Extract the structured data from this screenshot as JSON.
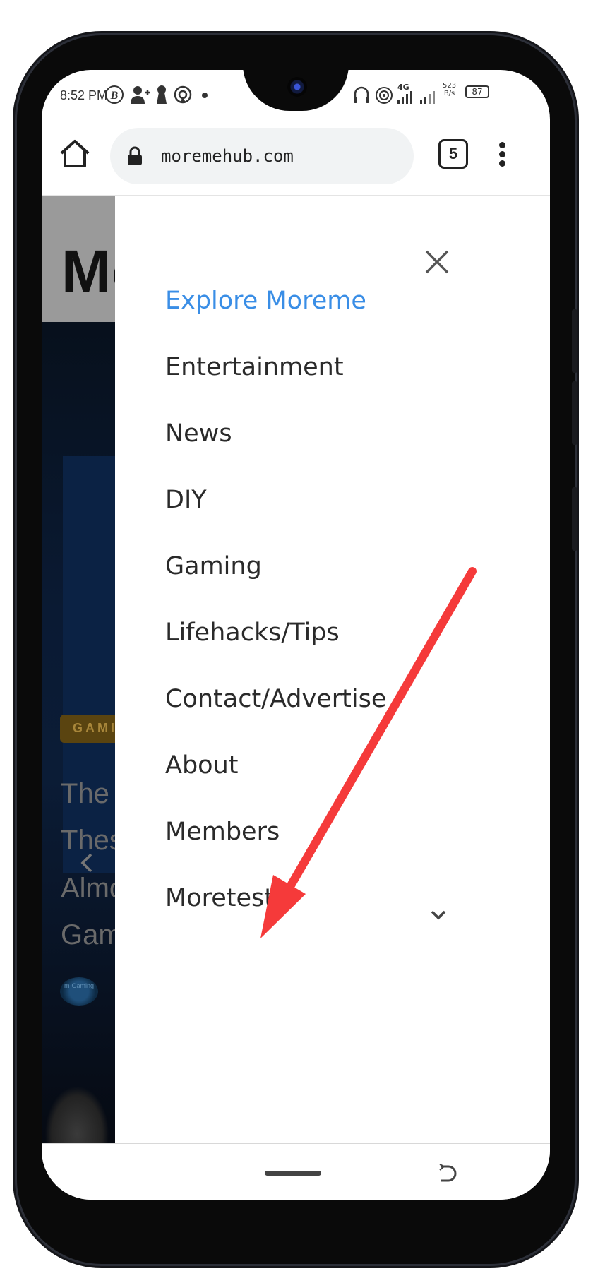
{
  "status_bar": {
    "time": "8:52 PM",
    "network": "4G",
    "speed_value": "523",
    "speed_unit": "B/s",
    "battery": "87",
    "icons": [
      "b-app-icon",
      "add-contact-icon",
      "keyhole-icon",
      "hotspot-icon",
      "dot-icon",
      "headset-icon",
      "wifi-icon",
      "signal-icon",
      "signal-icon-2",
      "battery-icon"
    ]
  },
  "browser": {
    "url": "moremehub.com",
    "tab_count": "5"
  },
  "background_page": {
    "logo_partial": "Mo",
    "badge": "GAMI",
    "title_lines": [
      "The S",
      "Thes",
      "Almo",
      "Gam"
    ],
    "avatar_text": "m-Gaming"
  },
  "drawer": {
    "items": [
      {
        "label": "Explore Moreme",
        "active": true
      },
      {
        "label": "Entertainment"
      },
      {
        "label": "News"
      },
      {
        "label": "DIY"
      },
      {
        "label": "Gaming"
      },
      {
        "label": "Lifehacks/Tips"
      },
      {
        "label": "Contact/Advertise"
      },
      {
        "label": "About"
      },
      {
        "label": "Members"
      },
      {
        "label": "Moretest",
        "has_submenu": true
      }
    ]
  },
  "colors": {
    "active_link": "#3a8ee6",
    "annotation_arrow": "#f53a3a",
    "badge_bg": "#5a4410"
  }
}
